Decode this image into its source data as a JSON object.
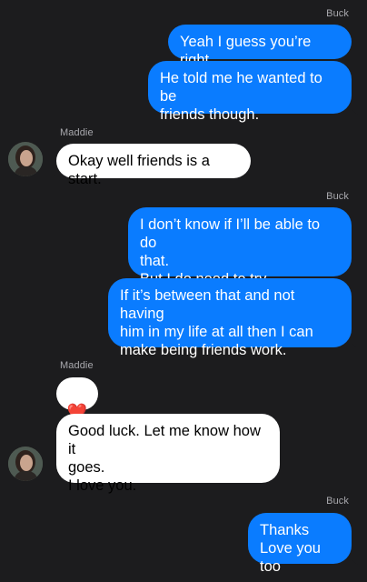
{
  "senders": {
    "buck": "Buck",
    "maddie": "Maddie"
  },
  "messages": {
    "m1": "Yeah I guess you’re right.",
    "m2": "He told me he wanted to be\nfriends though.",
    "m3": "Okay well friends is a start.",
    "m4": "I don’t know if I’ll be able to do\nthat.\nBut I do need to try.",
    "m5": "If it’s between that and not having\nhim in my life at all then I can\nmake being friends work.",
    "m6": "❤️",
    "m7": "Good luck. Let me know how it\ngoes.\nI love you.",
    "m8": "Thanks\nLove you too"
  },
  "icons": {
    "avatar": "contact-avatar-photo",
    "heart": "red-heart-emoji"
  },
  "colors": {
    "background": "#1c1c1e",
    "outgoing_bubble": "#0a7cff",
    "incoming_bubble": "#ffffff",
    "sender_label": "#a8a8ad",
    "heart": "#e0102b"
  }
}
